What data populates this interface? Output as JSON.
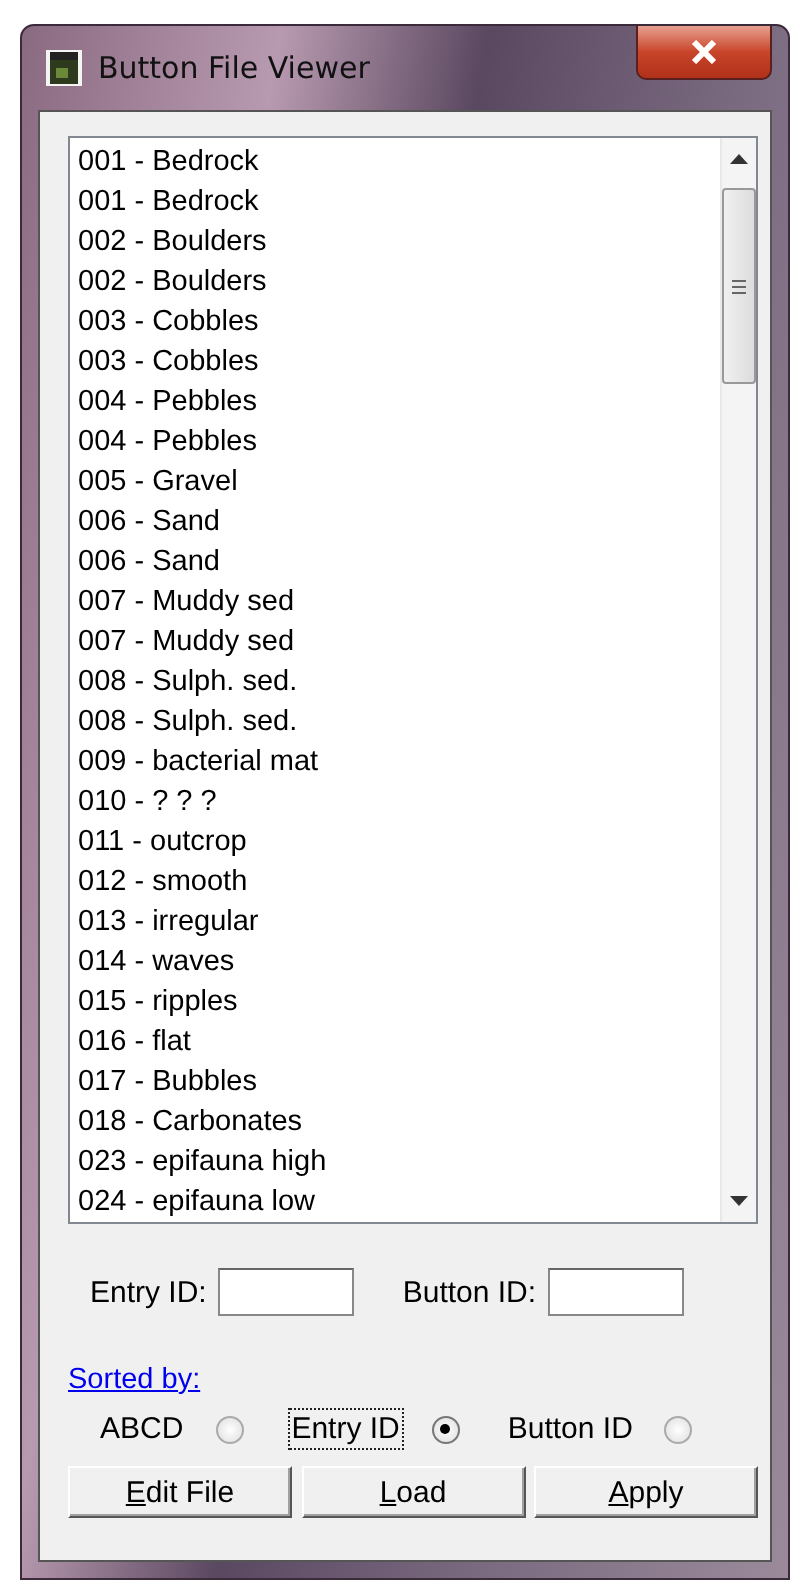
{
  "window": {
    "title": "Button File Viewer"
  },
  "list": {
    "items": [
      "001 - Bedrock",
      "001 - Bedrock",
      "002 - Boulders",
      "002 - Boulders",
      "003 - Cobbles",
      "003 - Cobbles",
      "004 - Pebbles",
      "004 - Pebbles",
      "005 - Gravel",
      "006 - Sand",
      "006 - Sand",
      "007 - Muddy sed",
      "007 - Muddy sed",
      "008 - Sulph. sed.",
      "008 - Sulph. sed.",
      "009 - bacterial mat",
      "010 - ? ? ?",
      "011 - outcrop",
      "012 - smooth",
      "013 - irregular",
      "014 - waves",
      "015 - ripples",
      "016 - flat",
      "017 - Bubbles",
      "018 - Carbonates",
      "023 - epifauna high",
      "024 - epifauna low"
    ]
  },
  "fields": [
    {
      "label": "Entry ID:"
    },
    {
      "label": "Button ID:"
    }
  ],
  "sorted_by": {
    "link": "Sorted by:",
    "options": [
      {
        "label": "ABCD",
        "selected": false,
        "focused": false
      },
      {
        "label": "Entry ID",
        "selected": true,
        "focused": true
      },
      {
        "label": "Button ID",
        "selected": false,
        "focused": false
      }
    ]
  },
  "buttons": [
    {
      "mnemonic": "E",
      "rest": "dit File"
    },
    {
      "mnemonic": "L",
      "rest": "oad"
    },
    {
      "mnemonic": "A",
      "rest": "pply"
    }
  ]
}
